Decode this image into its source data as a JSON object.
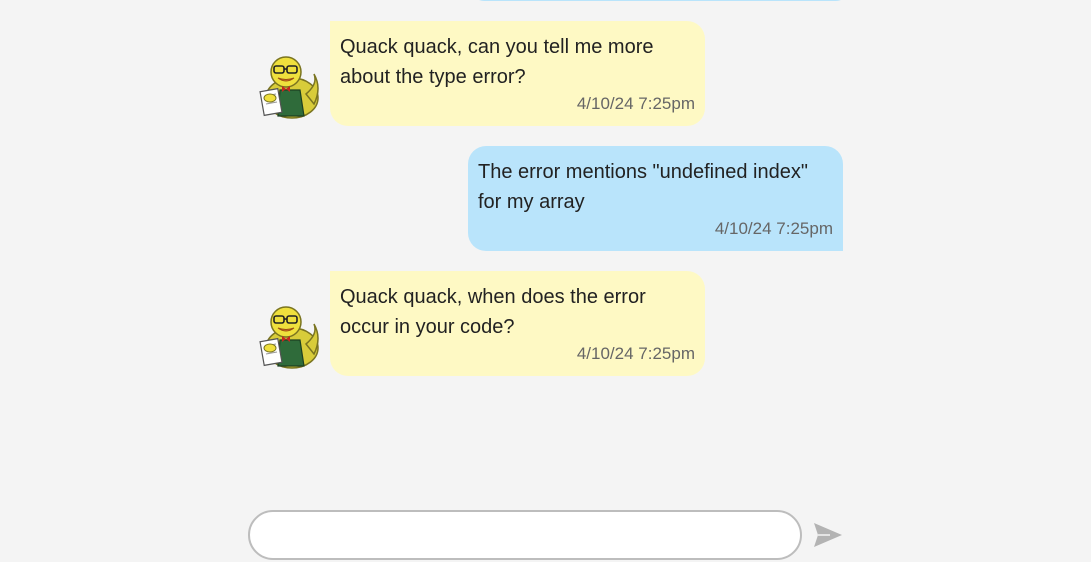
{
  "messages": [
    {
      "sender": "duck",
      "text": "Quack quack, can you tell me more about the type error?",
      "time": "4/10/24 7:25pm"
    },
    {
      "sender": "user",
      "text": "The error mentions \"undefined index\" for my array",
      "time": "4/10/24 7:25pm"
    },
    {
      "sender": "duck",
      "text": "Quack quack, when does the error occur in your code?",
      "time": "4/10/24 7:25pm"
    }
  ],
  "composer": {
    "value": "",
    "placeholder": ""
  },
  "icons": {
    "avatar": "rubber-duck-avatar",
    "send": "send-icon"
  },
  "colors": {
    "background": "#f4f4f4",
    "duck_bubble": "#fef9c4",
    "user_bubble": "#b9e4fb",
    "timestamp": "#666666",
    "send_icon": "#b3b3b3"
  }
}
